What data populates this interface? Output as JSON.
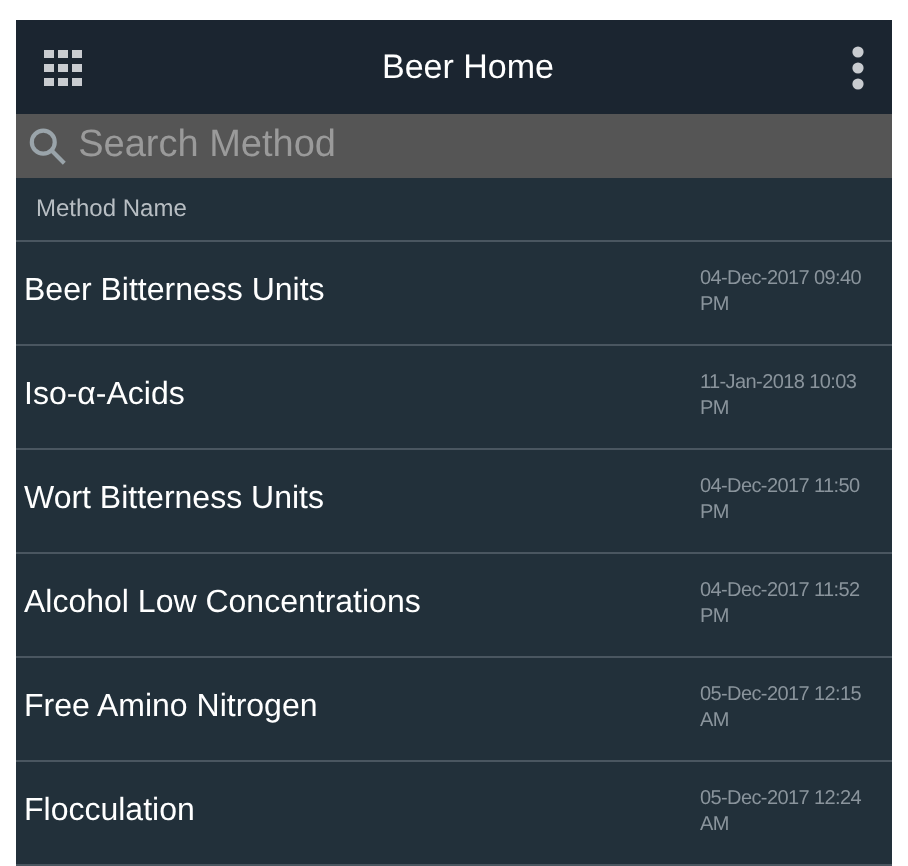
{
  "app_bar": {
    "title": "Beer Home"
  },
  "search": {
    "placeholder": "Search Method"
  },
  "list_header": "Method Name",
  "methods": [
    {
      "name": "Beer Bitterness Units",
      "date": "04-Dec-2017 09:40 PM"
    },
    {
      "name": "Iso-α-Acids",
      "date": "11-Jan-2018 10:03 PM"
    },
    {
      "name": "Wort Bitterness Units",
      "date": "04-Dec-2017 11:50 PM"
    },
    {
      "name": "Alcohol Low Concentrations",
      "date": "04-Dec-2017 11:52 PM"
    },
    {
      "name": "Free Amino Nitrogen",
      "date": "05-Dec-2017 12:15 AM"
    },
    {
      "name": "Flocculation",
      "date": "05-Dec-2017 12:24 AM"
    }
  ]
}
